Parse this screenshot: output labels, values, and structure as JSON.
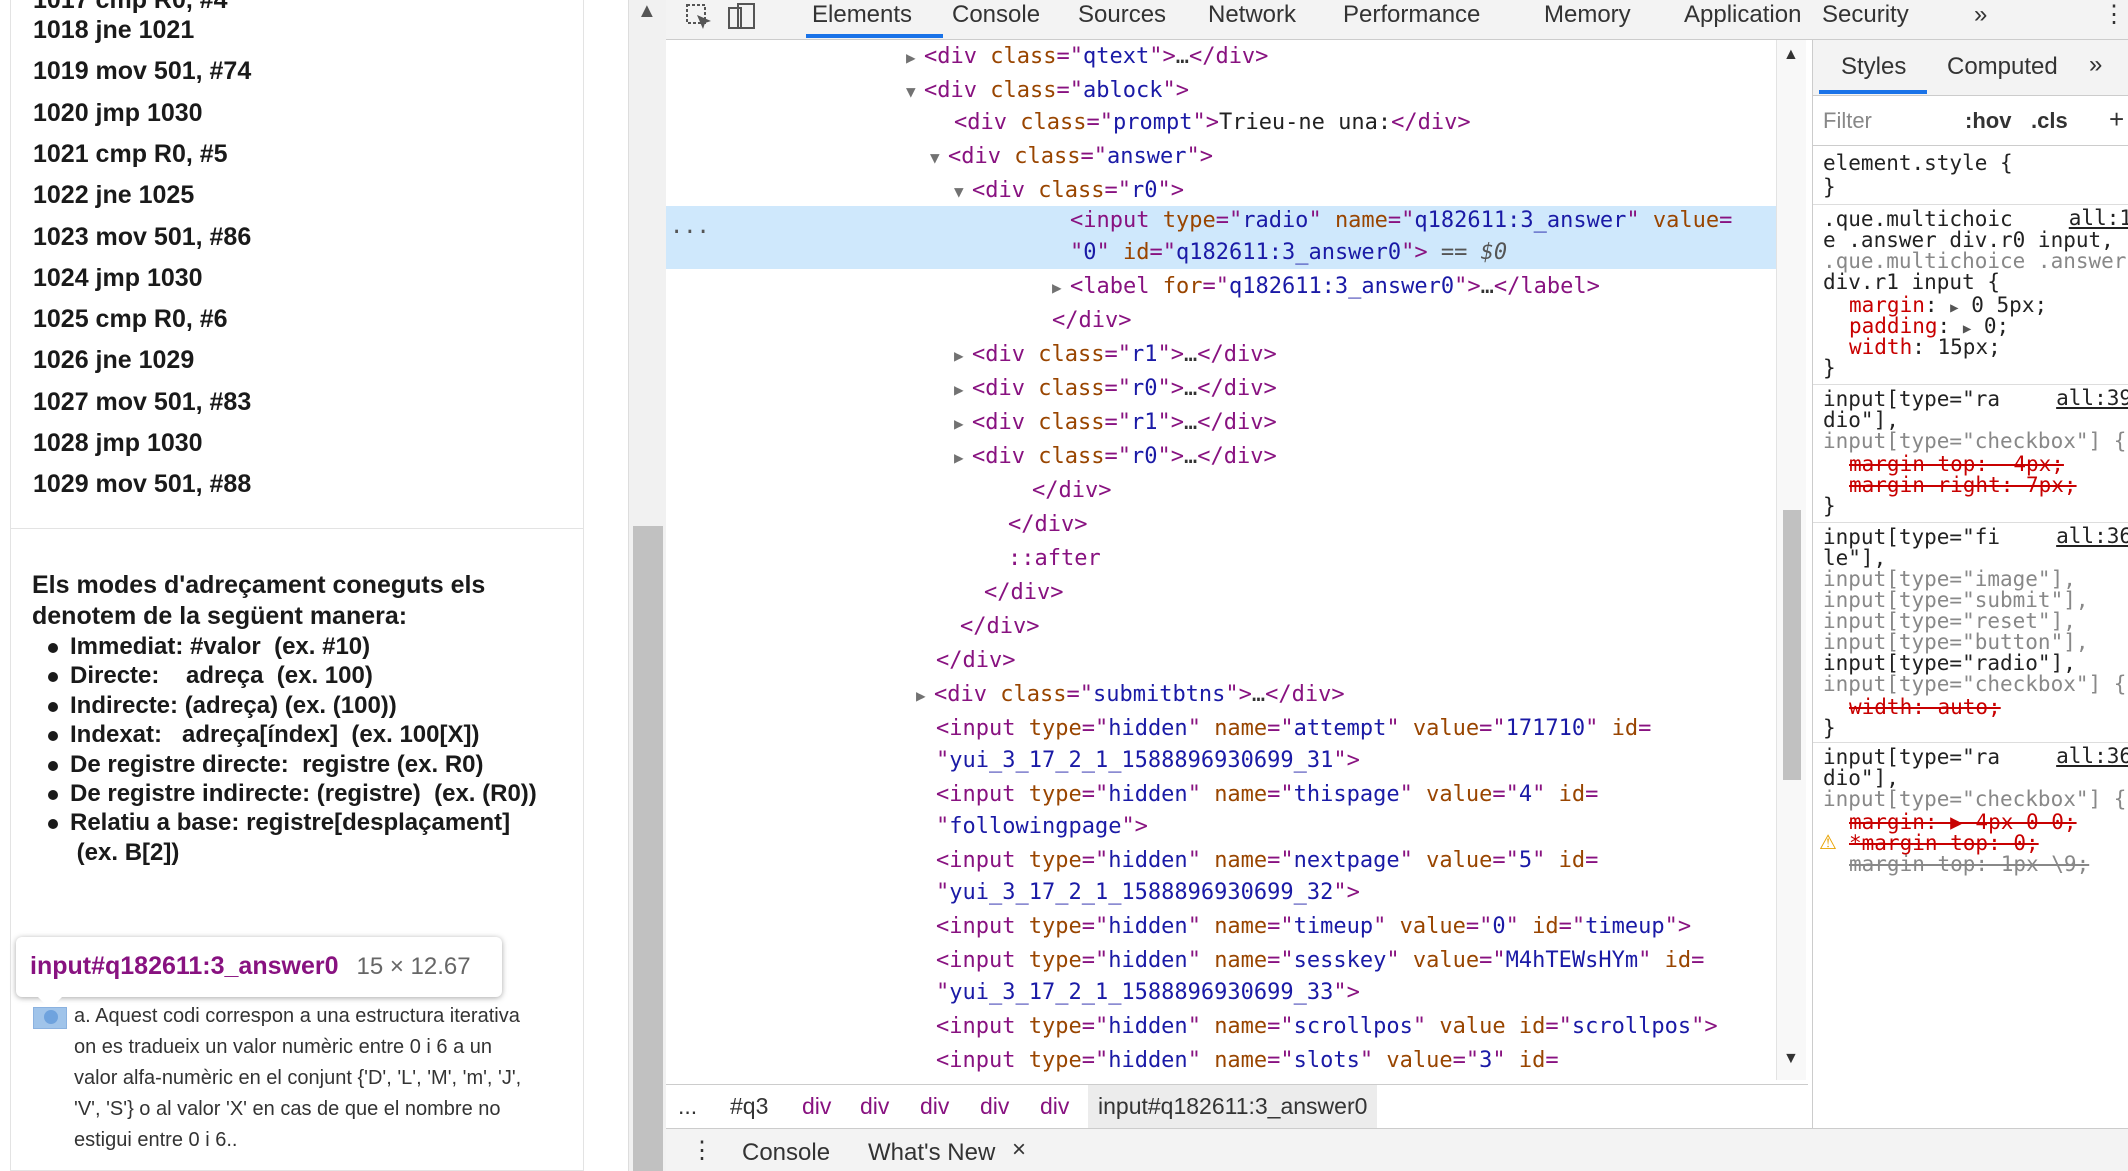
{
  "left": {
    "top_partial": "1017 cmp R0, #4",
    "code_lines": [
      "1018 jne 1021",
      "1019 mov 501, #74",
      "1020 jmp 1030",
      "1021 cmp R0, #5",
      "1022 jne 1025",
      "1023 mov 501, #86",
      "1024 jmp 1030",
      "1025 cmp R0, #6",
      "1026 jne 1029",
      "1027 mov 501, #83",
      "1028 jmp 1030",
      "1029 mov 501, #88"
    ],
    "modes_title": "Els modes d'adreçament coneguts els denotem de la següent manera:",
    "modes": [
      "Immediat: #valor  (ex. #10)",
      "Directe:    adreça  (ex. 100)",
      "Indirecte: (adreça) (ex. (100))",
      "Indexat:   adreça[índex]  (ex. 100[X])",
      "De registre directe:  registre (ex. R0)",
      "De registre indirecte: (registre)  (ex. (R0))",
      "Relatiu a base: registre[desplaçament]",
      " (ex. B[2])"
    ],
    "tooltip_tag": "input#q182611:3_answer0",
    "tooltip_size": "15 × 12.67",
    "answer_text": "a. Aquest codi correspon a una estructura iterativa on es tradueix un valor numèric entre 0 i 6 a un valor alfa-numèric en el conjunt {'D', 'L', 'M', 'm', 'J', 'V', 'S'} o al valor 'X' en cas de que el nombre no estigui entre 0 i 6.."
  },
  "devtools": {
    "tabs": [
      "Elements",
      "Console",
      "Sources",
      "Network",
      "Performance",
      "Memory",
      "Application",
      "Security"
    ],
    "active_tab": "Elements",
    "more_tabs": "»",
    "menu": "⋮",
    "styles_tabs": [
      "Styles",
      "Computed"
    ],
    "styles_more": "»",
    "filter_placeholder": "Filter",
    "hov": ":hov",
    "cls": ".cls",
    "add": "+",
    "breadcrumb": [
      "...",
      "#q3",
      "div",
      "div",
      "div",
      "div",
      "div",
      "input#q182611:3_answer0"
    ],
    "drawer_menu": "⋮",
    "drawer_tabs": [
      "Console",
      "What's New"
    ],
    "drawer_close": "×",
    "ellipsis": "..."
  },
  "dom": {
    "qtext_class": "qtext",
    "ablock_class": "ablock",
    "prompt_class": "prompt",
    "prompt_text": "Trieu-ne una:",
    "answer_class": "answer",
    "r0": "r0",
    "r1": "r1",
    "input_type": "radio",
    "input_name": "q182611:3_answer",
    "input_value": "0",
    "input_id": "q182611:3_answer0",
    "eq0": "== $0",
    "label_for": "q182611:3_answer0",
    "after": "::after",
    "submit_class": "submitbtns",
    "hidden": "hidden",
    "attempt_name": "attempt",
    "attempt_value": "171710",
    "attempt_id": "yui_3_17_2_1_1588896930699_31",
    "thispage_name": "thispage",
    "thispage_value": "4",
    "thispage_id": "followingpage",
    "nextpage_name": "nextpage",
    "nextpage_value": "5",
    "nextpage_id": "yui_3_17_2_1_1588896930699_32",
    "timeup_name": "timeup",
    "timeup_value": "0",
    "timeup_id": "timeup",
    "sesskey_name": "sesskey",
    "sesskey_value": "M4hTEWsHYm",
    "sesskey_id": "yui_3_17_2_1_1588896930699_33",
    "scrollpos_name": "scrollpos",
    "scrollpos_id": "scrollpos",
    "slots_name": "slots",
    "slots_value": "3"
  },
  "styles": {
    "element_style": "element.style {",
    "close": "}",
    "r1_sel1": ".que.multichoic",
    "r1_sel2": "e .answer div.r0 input,",
    "r1_sel3": ".que.multichoice .answer",
    "r1_sel4": "div.r1 input {",
    "r1_src": "all:1",
    "r1_margin_name": "margin",
    "r1_margin_val": "0 5px;",
    "r1_padding_name": "padding",
    "r1_padding_val": "0;",
    "r1_width_name": "width",
    "r1_width_val": "15px;",
    "r2_sel1": "input[type=\"ra",
    "r2_sel2": "dio\"],",
    "r2_sel3": "input[type=\"checkbox\"] {",
    "r2_src": "all:39",
    "r2_p1": "margin-top: -4px;",
    "r2_p2": "margin-right: 7px;",
    "r3_sel1": "input[type=\"fi",
    "r3_sel2": "le\"],",
    "r3_sel3": "input[type=\"image\"],",
    "r3_sel4": "input[type=\"submit\"],",
    "r3_sel5": "input[type=\"reset\"],",
    "r3_sel6": "input[type=\"button\"],",
    "r3_sel7": "input[type=\"radio\"],",
    "r3_sel8": "input[type=\"checkbox\"] {",
    "r3_src": "all:36",
    "r3_p1": "width: auto;",
    "r4_sel1": "input[type=\"ra",
    "r4_sel2": "dio\"],",
    "r4_sel3": "input[type=\"checkbox\"] {",
    "r4_src": "all:36",
    "r4_p1": "margin: ▶ 4px 0 0;",
    "r4_p2": "*margin-top: 0;",
    "r4_p3": "margin-top: 1px \\9;",
    "warning_icon": "warning-icon"
  }
}
